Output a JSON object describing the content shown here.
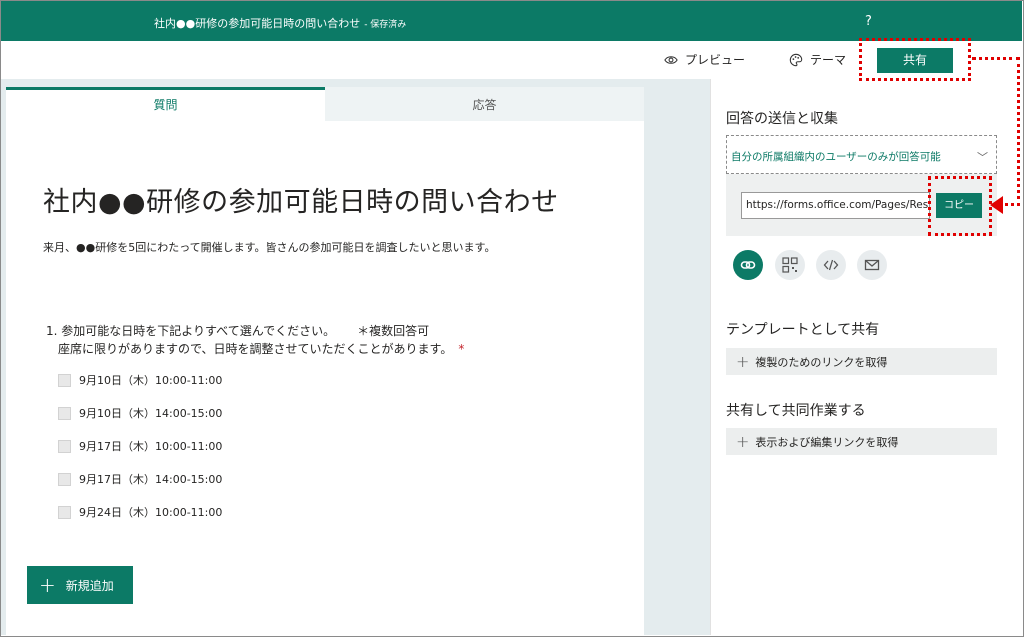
{
  "header": {
    "title": "社内●●研修の参加可能日時の問い合わせ",
    "saved_status": "- 保存済み",
    "help": "?"
  },
  "commandbar": {
    "preview": "プレビュー",
    "theme": "テーマ",
    "share": "共有"
  },
  "tabs": {
    "questions": "質問",
    "responses": "応答"
  },
  "form": {
    "title": "社内●●研修の参加可能日時の問い合わせ",
    "description": "来月、●●研修を5回にわたって開催します。皆さんの参加可能日を調査したいと思います。",
    "question": {
      "text": "1. 参加可能な日時を下記よりすべて選んでください。",
      "multi_note": "＊複数回答可",
      "subtext": "座席に限りがありますので、日時を調整させていただくことがあります。",
      "required_mark": "*",
      "options": [
        "9月10日（木）10:00-11:00",
        "9月10日（木）14:00-15:00",
        "9月17日（木）10:00-11:00",
        "9月17日（木）14:00-15:00",
        "9月24日（木）10:00-11:00"
      ]
    },
    "add_new": "新規追加"
  },
  "share_panel": {
    "send_heading": "回答の送信と収集",
    "audience_option": "自分の所属組織内のユーザーのみが回答可能",
    "url": "https://forms.office.com/Pages/ResponsePage.aspx",
    "copy": "コピー",
    "template_heading": "テンプレートとして共有",
    "duplicate_link": "複製のためのリンクを取得",
    "collab_heading": "共有して共同作業する",
    "edit_link": "表示および編集リンクを取得"
  },
  "colors": {
    "accent": "#0c7a66",
    "annotation": "#e00000"
  }
}
